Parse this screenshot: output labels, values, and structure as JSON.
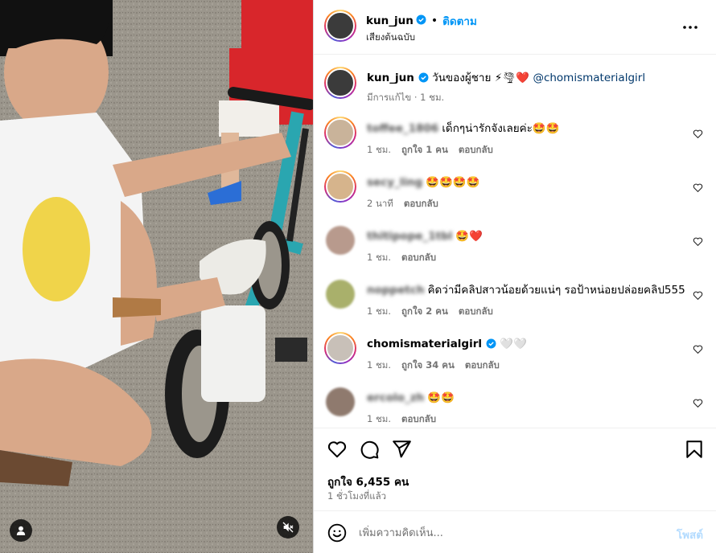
{
  "colors": {
    "accent": "#0095f6",
    "verified": "#0095f6",
    "muted": "#737373",
    "heart": "#ed4956"
  },
  "media": {
    "tag_icon": "user-tag-icon",
    "mute_icon": "speaker-muted-icon"
  },
  "header": {
    "username": "kun_jun",
    "dot": "•",
    "follow_label": "ติดตาม",
    "audio": "เสียงต้นฉบับ",
    "more_icon": "more-horizontal-icon"
  },
  "caption": {
    "username": "kun_jun",
    "text": "วันของผู้ชาย ⚡🌪❤️",
    "mention": "@chomismaterialgirl",
    "meta": "มีการแก้ไข · 1 ชม."
  },
  "comments": [
    {
      "username": "toffee_1806",
      "blurred": true,
      "text": "เด็กๆน่ารักจังเลยค่ะ🤩🤩",
      "time": "1 ชม.",
      "likes": "ถูกใจ 1 คน",
      "reply": "ตอบกลับ"
    },
    {
      "username": "secy_ling",
      "blurred": true,
      "text": "🤩🤩🤩🤩",
      "time": "2 นาที",
      "likes": "",
      "reply": "ตอบกลับ"
    },
    {
      "username": "thitipope_1tbl",
      "blurred": true,
      "text": "🤩❤️",
      "time": "1 ชม.",
      "likes": "",
      "reply": "ตอบกลับ"
    },
    {
      "username": "noppetch",
      "blurred": true,
      "text": "คิดว่ามีคลิปสาวน้อยด้วยแน่ๆ รอป้าหน่อยปล่อยคลิป555",
      "time": "1 ชม.",
      "likes": "ถูกใจ 2 คน",
      "reply": "ตอบกลับ"
    },
    {
      "username": "chomismaterialgirl",
      "blurred": false,
      "verified": true,
      "text": "🤍🤍",
      "time": "1 ชม.",
      "likes": "ถูกใจ 34 คน",
      "reply": "ตอบกลับ"
    },
    {
      "username": "ercolo_zh",
      "blurred": true,
      "text": "🤩🤩",
      "time": "1 ชม.",
      "likes": "",
      "reply": "ตอบกลับ"
    }
  ],
  "actions": {
    "like_icon": "heart-icon",
    "comment_icon": "comment-icon",
    "share_icon": "paper-plane-icon",
    "save_icon": "bookmark-icon",
    "likes_count": "ถูกใจ 6,455 คน",
    "posted": "1 ชั่วโมงที่แล้ว"
  },
  "composer": {
    "emoji_icon": "emoji-smile-icon",
    "placeholder": "เพิ่มความคิดเห็น...",
    "post_label": "โพสต์"
  }
}
